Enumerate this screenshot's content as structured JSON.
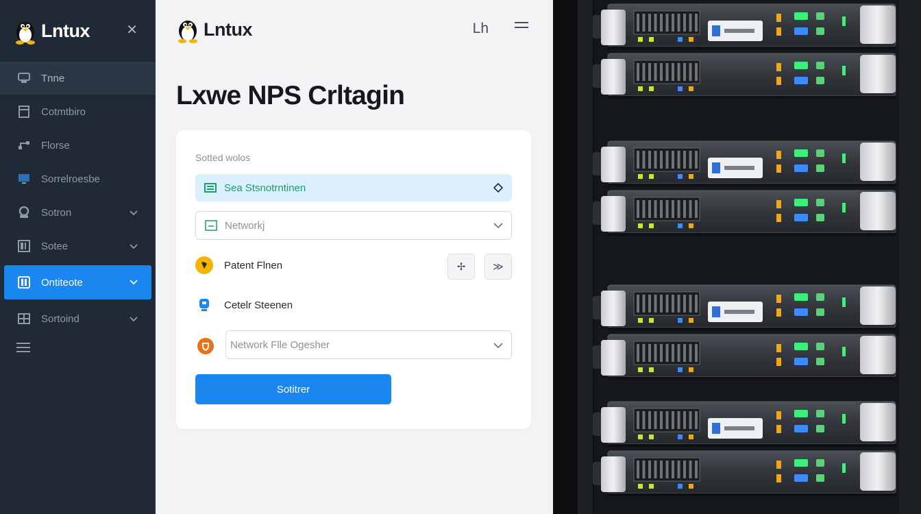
{
  "app": {
    "brand": "Lntux"
  },
  "sidebar": {
    "brand": "Lntux",
    "items": [
      {
        "label": "Tnne",
        "icon": "dashboard-icon",
        "state": "hover",
        "chevron": false
      },
      {
        "label": "Cotmtbiro",
        "icon": "file-icon",
        "state": "normal",
        "chevron": false
      },
      {
        "label": "Florse",
        "icon": "branch-icon",
        "state": "normal",
        "chevron": false
      },
      {
        "label": "Sorrelroesbe",
        "icon": "monitor-icon",
        "state": "normal",
        "chevron": false
      },
      {
        "label": "Sotron",
        "icon": "user-icon",
        "state": "normal",
        "chevron": true
      },
      {
        "label": "Sotee",
        "icon": "book-icon",
        "state": "normal",
        "chevron": true
      },
      {
        "label": "Ontiteote",
        "icon": "book-icon",
        "state": "active",
        "chevron": true
      },
      {
        "label": "Sortoind",
        "icon": "grid-icon",
        "state": "normal",
        "chevron": true
      }
    ]
  },
  "header": {
    "brand": "Lntux",
    "page_title": "Lxwe NPS Crltagin",
    "btn_text": "Lh"
  },
  "form": {
    "section_label": "Sotted wolos",
    "select1": "Sea Stsnotrntinen",
    "select2_placeholder": "Networkj",
    "row1_label": "Patent Flnen",
    "row2_label": "Cetelr Steenen",
    "select3_placeholder": "Network Flle Ogesher",
    "submit_label": "Sotitrer",
    "btn1_glyph": "✢",
    "btn2_glyph": "≫"
  },
  "colors": {
    "sidebar_bg": "#1f2a36",
    "accent": "#1a86f0",
    "select_highlight": "#dcefff",
    "select_text": "#1a9e66"
  }
}
